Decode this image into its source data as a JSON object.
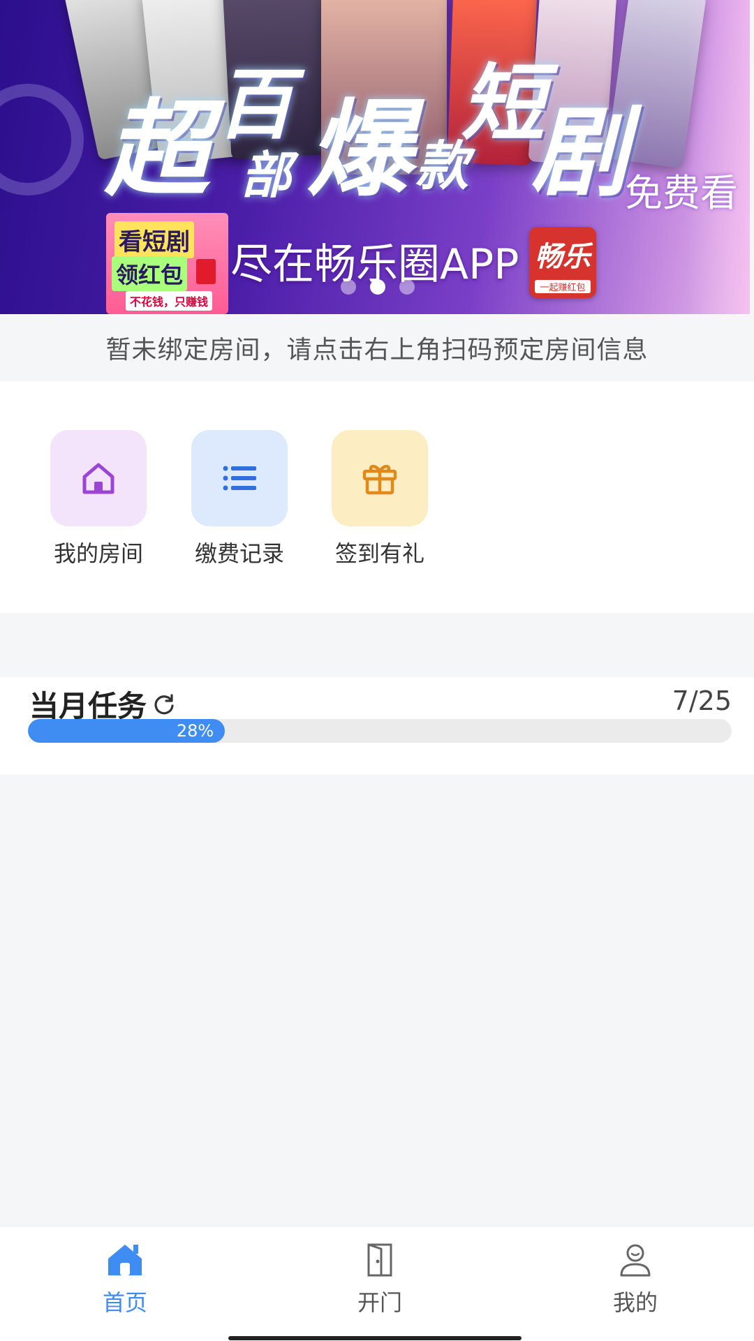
{
  "banner": {
    "title_chars": [
      "超",
      "百",
      "部",
      "爆",
      "款",
      "短",
      "剧"
    ],
    "free_text": "免费看",
    "subline": "尽在畅乐圈APP",
    "promo_line1": "看短剧",
    "promo_line2": "领红包",
    "promo_line3": "不花钱，只赚钱",
    "app_logo_text": "畅乐",
    "app_logo_sub": "一起赚红包",
    "dot_count": 3,
    "active_dot": 1
  },
  "notice": "暂未绑定房间，请点击右上角扫码预定房间信息",
  "menu": {
    "items": [
      {
        "label": "我的房间",
        "icon": "house-icon",
        "color": "#9b45d6"
      },
      {
        "label": "缴费记录",
        "icon": "list-icon",
        "color": "#2f6fe0"
      },
      {
        "label": "签到有礼",
        "icon": "gift-icon",
        "color": "#e08a1a"
      }
    ]
  },
  "task": {
    "title": "当月任务",
    "count": "7/25",
    "progress_label": "28%",
    "progress": 0.28
  },
  "tabbar": {
    "tabs": [
      {
        "label": "首页",
        "icon": "home-icon",
        "active": true
      },
      {
        "label": "开门",
        "icon": "door-icon",
        "active": false
      },
      {
        "label": "我的",
        "icon": "profile-icon",
        "active": false
      }
    ],
    "active_color": "#3f8cf3"
  }
}
